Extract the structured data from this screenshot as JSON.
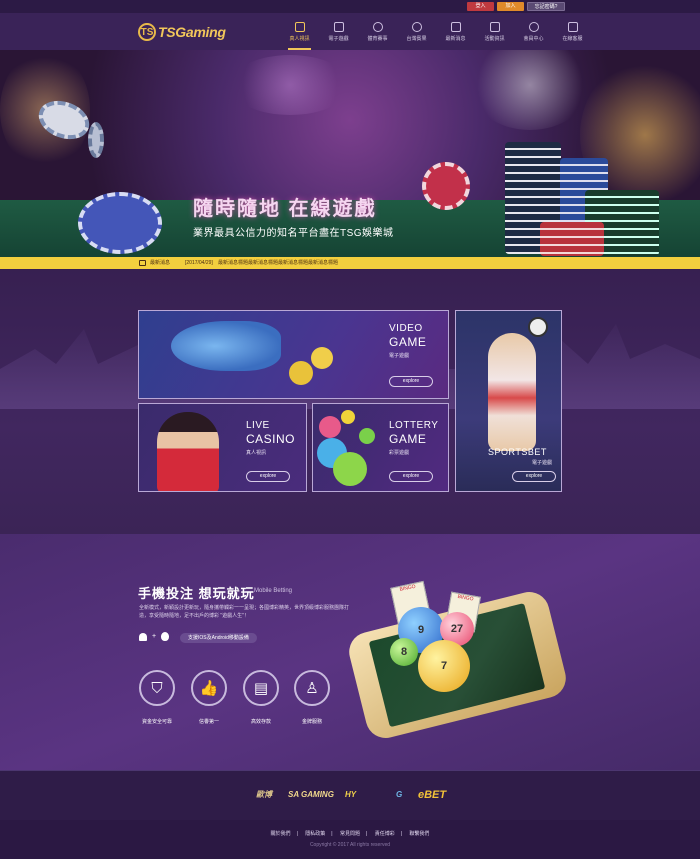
{
  "topbar": {
    "login": "登入",
    "join": "加入",
    "forgot": "忘記密碼?"
  },
  "brand": {
    "logo_mark": "TS",
    "logo_text": "TSGaming"
  },
  "nav": [
    {
      "label": "真人視訊",
      "icon": "dealer-icon",
      "active": true
    },
    {
      "label": "電子遊戲",
      "icon": "slot-icon",
      "active": false
    },
    {
      "label": "體育賽事",
      "icon": "ball-icon",
      "active": false
    },
    {
      "label": "台灣賓果",
      "icon": "bingo-icon",
      "active": false
    },
    {
      "label": "最新消息",
      "icon": "news-icon",
      "active": false
    },
    {
      "label": "活動資訊",
      "icon": "gift-icon",
      "active": false
    },
    {
      "label": "會員中心",
      "icon": "member-icon",
      "active": false
    },
    {
      "label": "在線客服",
      "icon": "support-icon",
      "active": false
    }
  ],
  "banner": {
    "title": "隨時隨地  在線遊戲",
    "subtitle": "業界最具公信力的知名平台盡在TSG娛樂城"
  },
  "ticker": {
    "label": "最新消息",
    "date": "[2017/04/29]",
    "text": "最新消息標題最新消息標題最新消息標題最新消息標題"
  },
  "games": {
    "video": {
      "title1": "VIDEO",
      "title2": "GAME",
      "sub": "電子遊戲",
      "button": "explore"
    },
    "sports": {
      "title": "SPORTSBET",
      "sub": "電子遊戲",
      "button": "explore"
    },
    "live": {
      "title1": "LIVE",
      "title2": "CASINO",
      "sub": "真人視訊",
      "button": "explore"
    },
    "lottery": {
      "title1": "LOTTERY",
      "title2": "GAME",
      "sub": "彩票遊戲",
      "button": "explore"
    }
  },
  "mobile": {
    "title": "手機投注  想玩就玩",
    "title_en": "Mobile Betting",
    "description": "全新模式，新穎設計更新玩，隨身攜帶觸彩一一呈現；各國博彩精英，世界頂級博彩服務團隊打造，享受隨時隨地，足不出戶的博彩 \"遊戲人生\"！",
    "os": "+",
    "support": "支援IOS及Android移動設備",
    "features": [
      {
        "label": "資金安全可靠",
        "icon": "shield-icon"
      },
      {
        "label": "信譽第一",
        "icon": "thumbs-up-icon"
      },
      {
        "label": "高效存款",
        "icon": "deposit-icon"
      },
      {
        "label": "金牌服務",
        "icon": "service-icon"
      }
    ],
    "balls": [
      "9",
      "27",
      "7",
      "8"
    ],
    "bingo": [
      "BINGO",
      "BINGO"
    ]
  },
  "partners": [
    {
      "name": "歐博",
      "color": "#d9c28a"
    },
    {
      "name": "SA GAMING",
      "color": "#f0d78c"
    },
    {
      "name": "HY",
      "color": "#f3d34a"
    },
    {
      "name": "G",
      "color": "#6fb8e8"
    },
    {
      "name": "eBET",
      "color": "#f2c238"
    }
  ],
  "footer": {
    "links": [
      "關於我們",
      "隱私政策",
      "常見問題",
      "責任博彩",
      "聯繫我們"
    ],
    "copyright": "Copyright © 2017 All rights reserved"
  },
  "colors": {
    "accent": "#f1c65a",
    "ticker": "#f3cf3e",
    "background": "#3b2456"
  }
}
